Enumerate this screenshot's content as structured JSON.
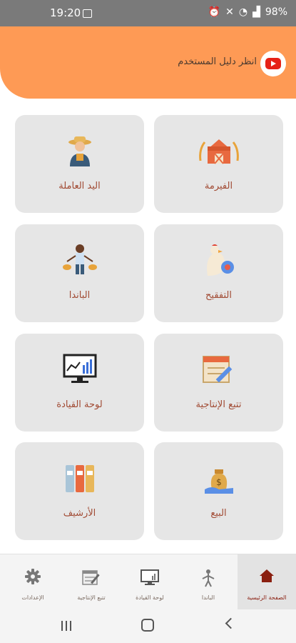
{
  "status_bar": {
    "time": "19:20",
    "battery": "98%"
  },
  "header": {
    "guide_text": "انظر دليل المستخدم",
    "accent_color": "#fe9a55"
  },
  "cards": [
    {
      "id": "farm",
      "label": "الفيرمة",
      "icon": "barn-icon"
    },
    {
      "id": "workforce",
      "label": "اليد العاملة",
      "icon": "farmer-icon"
    },
    {
      "id": "hatching",
      "label": "التفقيح",
      "icon": "chick-egg-icon"
    },
    {
      "id": "panda",
      "label": "الباندا",
      "icon": "worker-scale-icon"
    },
    {
      "id": "production",
      "label": "تتبع الإنتاجية",
      "icon": "calendar-pencil-icon"
    },
    {
      "id": "dashboard",
      "label": "لوحة القيادة",
      "icon": "monitor-chart-icon"
    },
    {
      "id": "sales",
      "label": "البيع",
      "icon": "money-bag-icon"
    },
    {
      "id": "archive",
      "label": "الأرشيف",
      "icon": "binders-icon"
    }
  ],
  "bottom_nav": [
    {
      "label": "الصفحة الرئيسية",
      "icon": "home-icon",
      "active": true
    },
    {
      "label": "الباندا",
      "icon": "worker-icon",
      "active": false
    },
    {
      "label": "لوحة القيادة",
      "icon": "monitor-icon",
      "active": false
    },
    {
      "label": "تتبع الإنتاجية",
      "icon": "calendar-icon",
      "active": false
    },
    {
      "label": "الإعدادات",
      "icon": "gear-icon",
      "active": false
    }
  ]
}
